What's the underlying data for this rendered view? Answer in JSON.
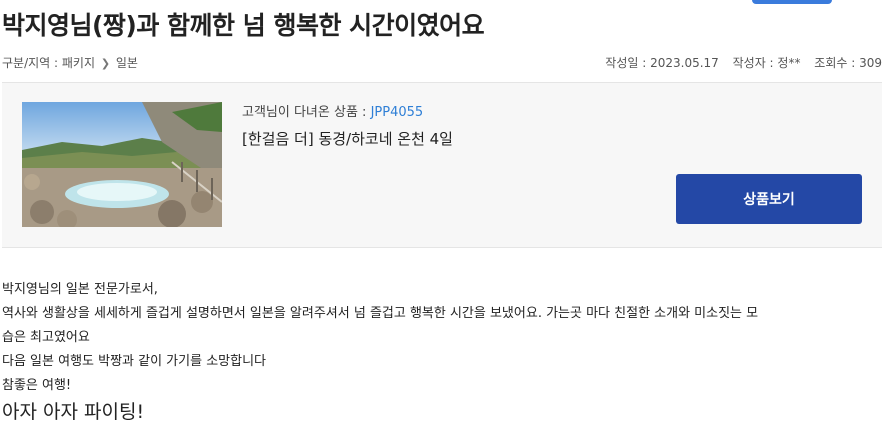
{
  "review": {
    "title": "박지영님(짱)과 함께한 넘 행복한 시간이였어요",
    "category": {
      "label": "구분/지역 : 패키지",
      "region": "일본"
    },
    "meta": {
      "date": "작성일 : 2023.05.17",
      "author": "작성자 : 정**",
      "views": "조회수 : 309"
    },
    "product": {
      "visited_label": "고객님이 다녀온 상품 : ",
      "code": "JPP4055",
      "name": "[한걸음 더] 동경/하코네 온천 4일",
      "button_label": "상품보기"
    },
    "body": {
      "line1": "박지영님의 일본 전문가로서,",
      "line2": "역사와 생활상을 세세하게 즐겁게 설명하면서 일본을 알려주셔서 넘 즐겁고 행복한 시간을 보냈어요. 가는곳 마다 친절한 소개와 미소짓는 모",
      "line3": "습은 최고였어요",
      "line4": "다음 일본 여행도 박짱과 같이 가기를 소망합니다",
      "line5": "참좋은 여행!",
      "line6": "아자 아자 파이팅!"
    }
  },
  "colors": {
    "accent_link": "#2f7fd6",
    "button_bg": "#2448a6"
  },
  "icons": {
    "breadcrumb_separator": "chevron-right-icon"
  }
}
